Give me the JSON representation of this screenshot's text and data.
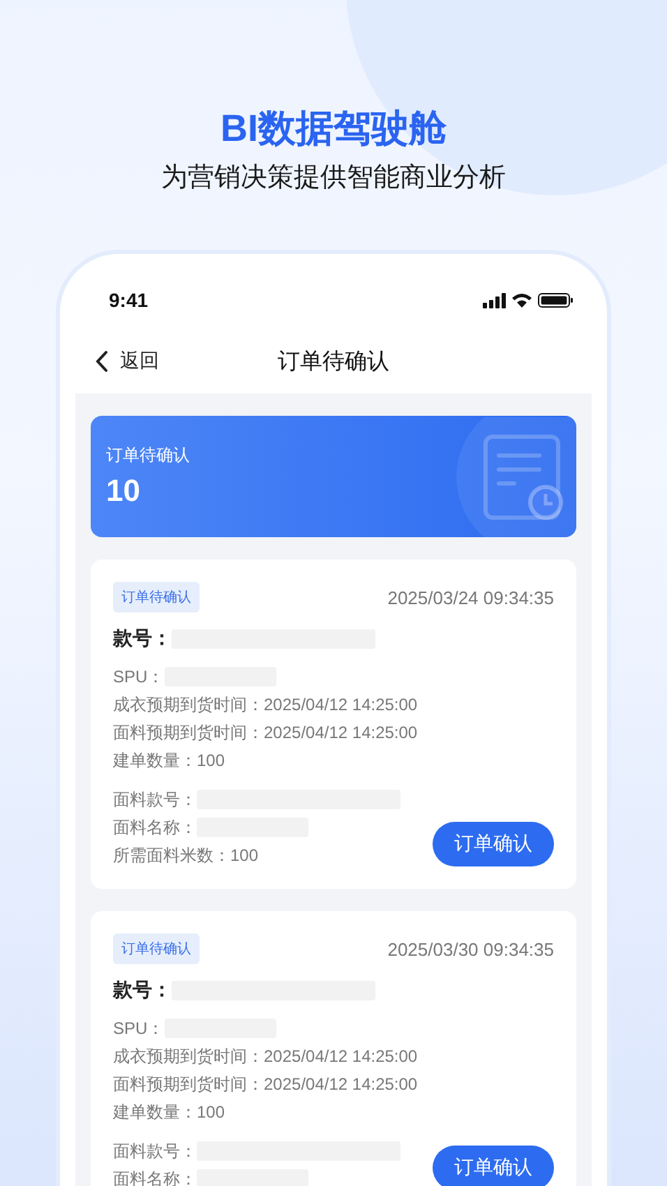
{
  "headline": {
    "title": "BI数据驾驶舱",
    "subtitle": "为营销决策提供智能商业分析"
  },
  "status_bar": {
    "time": "9:41"
  },
  "nav": {
    "back": "返回",
    "title": "订单待确认"
  },
  "summary": {
    "label": "订单待确认",
    "count": "10"
  },
  "orders": [
    {
      "tag": "订单待确认",
      "time": "2025/03/24 09:34:35",
      "style_label": "款号：",
      "details": [
        {
          "kind": "blank",
          "label": "SPU："
        },
        {
          "kind": "text",
          "label": "成衣预期到货时间：",
          "value": "2025/04/12 14:25:00"
        },
        {
          "kind": "text",
          "label": "面料预期到货时间：",
          "value": "2025/04/12 14:25:00"
        },
        {
          "kind": "text",
          "label": "建单数量：",
          "value": "100"
        }
      ],
      "materials": [
        {
          "kind": "blank",
          "label": "面料款号："
        },
        {
          "kind": "blank",
          "label": "面料名称："
        },
        {
          "kind": "text",
          "label": "所需面料米数：",
          "value": "100"
        }
      ],
      "button": "订单确认"
    },
    {
      "tag": "订单待确认",
      "time": "2025/03/30 09:34:35",
      "style_label": "款号：",
      "details": [
        {
          "kind": "blank",
          "label": "SPU："
        },
        {
          "kind": "text",
          "label": "成衣预期到货时间：",
          "value": "2025/04/12 14:25:00"
        },
        {
          "kind": "text",
          "label": "面料预期到货时间：",
          "value": "2025/04/12 14:25:00"
        },
        {
          "kind": "text",
          "label": "建单数量：",
          "value": "100"
        }
      ],
      "materials": [
        {
          "kind": "blank",
          "label": "面料款号："
        },
        {
          "kind": "blank",
          "label": "面料名称："
        }
      ],
      "button": "订单确认"
    }
  ]
}
